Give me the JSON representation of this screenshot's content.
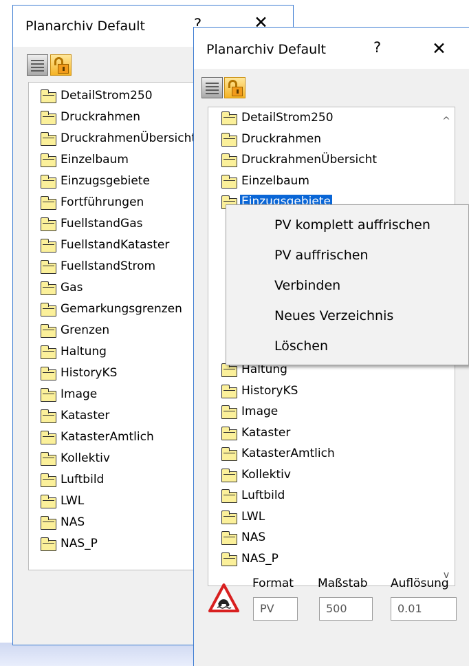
{
  "back_window": {
    "title": "Planarchiv Default",
    "help": "?",
    "close": "✕",
    "items": [
      "DetailStrom250",
      "Druckrahmen",
      "DruckrahmenÜbersicht",
      "Einzelbaum",
      "Einzugsgebiete",
      "Fortführungen",
      "FuellstandGas",
      "FuellstandKataster",
      "FuellstandStrom",
      "Gas",
      "Gemarkungsgrenzen",
      "Grenzen",
      "Haltung",
      "HistoryKS",
      "Image",
      "Kataster",
      "KatasterAmtlich",
      "Kollektiv",
      "Luftbild",
      "LWL",
      "NAS",
      "NAS_P"
    ]
  },
  "front_window": {
    "title": "Planarchiv Default",
    "help": "?",
    "close": "✕",
    "items": [
      "DetailStrom250",
      "Druckrahmen",
      "DruckrahmenÜbersicht",
      "Einzelbaum",
      "Einzugsgebiete",
      "",
      "",
      "",
      "",
      "",
      "",
      "",
      "Haltung",
      "HistoryKS",
      "Image",
      "Kataster",
      "KatasterAmtlich",
      "Kollektiv",
      "Luftbild",
      "LWL",
      "NAS",
      "NAS_P"
    ],
    "selected_item": "Einzugsgebiete",
    "scroll_up": "^",
    "scroll_down": "v",
    "context_menu": [
      "PV komplett auffrischen",
      "PV auffrischen",
      "Verbinden",
      "Neues Verzeichnis",
      "Löschen"
    ],
    "fields": {
      "format_label": "Format",
      "format_value": "PV",
      "scale_label": "Maßstab",
      "scale_value": "500",
      "resolution_label": "Auflösung",
      "resolution_value": "0.01"
    },
    "icons": {
      "list_toggle": "list-view-icon",
      "lock": "unlocked-padlock-icon",
      "warning": "warning-triangle-icon"
    }
  }
}
